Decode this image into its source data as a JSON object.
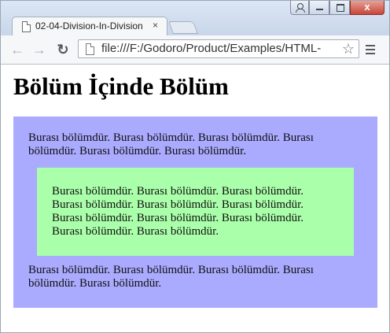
{
  "browser": {
    "tab_title": "02-04-Division-In-Division",
    "tab_close": "×",
    "url": "file:///F:/Godoro/Product/Examples/HTML-",
    "back_glyph": "←",
    "forward_glyph": "→",
    "reload_glyph": "↻",
    "close_glyph": "x",
    "star_glyph": "☆"
  },
  "page": {
    "heading": "Bölüm İçinde Bölüm",
    "outer_paragraph_1": "Burası bölümdür. Burası bölümdür. Burası bölümdür. Burası bölümdür. Burası bölümdür. Burası bölümdür.",
    "inner_paragraph": "Burası bölümdür. Burası bölümdür. Burası bölümdür. Burası bölümdür. Burası bölümdür. Burası bölümdür. Burası bölümdür. Burası bölümdür. Burası bölümdür. Burası bölümdür. Burası bölümdür.",
    "outer_paragraph_2": "Burası bölümdür. Burası bölümdür. Burası bölümdür. Burası bölümdür. Burası bölümdür."
  },
  "colors": {
    "outer_division": "#aaaaff",
    "inner_division": "#aaffaa"
  }
}
